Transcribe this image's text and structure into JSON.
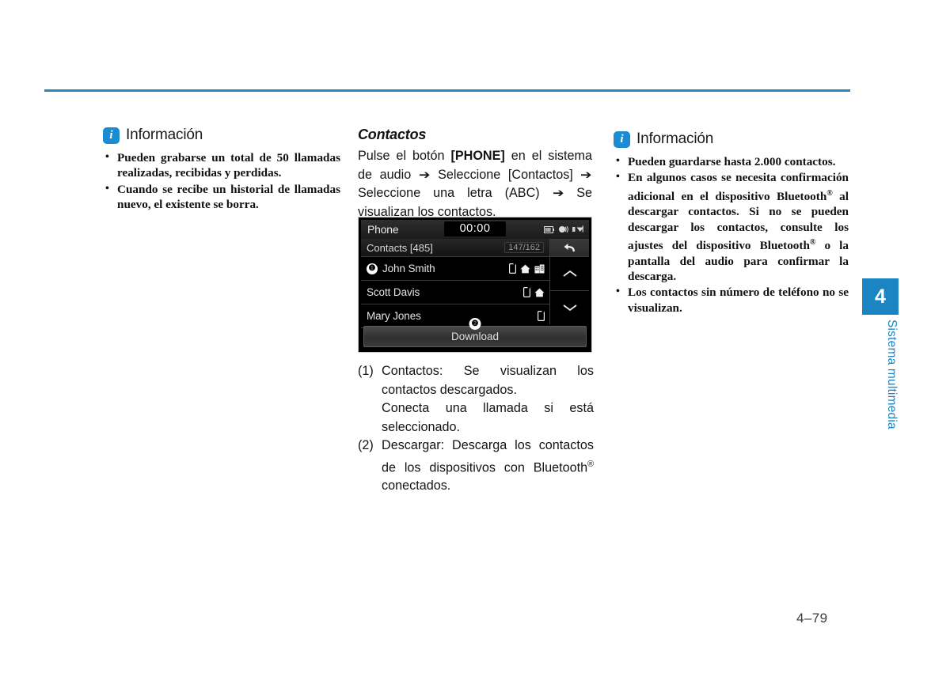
{
  "page": {
    "number": "4–79",
    "chapter_tab": {
      "number": "4",
      "label": "Sistema multimedia"
    }
  },
  "left_column": {
    "info_heading": "Información",
    "info_icon": "info-icon",
    "bullets": [
      "Pueden grabarse un total de 50 llamadas realizadas, recibidas y perdidas.",
      "Cuando se recibe un historial de llamadas nuevo, el existente se borra."
    ]
  },
  "middle_column": {
    "title": "Contactos",
    "paragraph": {
      "part1": "Pulse el botón ",
      "bold1": "[PHONE]",
      "part2": " en el sistema de audio ",
      "arrow1": "➔",
      "part3": " Seleccione [Contactos] ",
      "arrow2": "➔",
      "part4": " Seleccione una letra (ABC) ",
      "arrow3": "➔",
      "part5": " Se visualizan los contactos."
    },
    "numbered_items": [
      {
        "num": "(1)",
        "text": "Contactos: Se visualizan los contactos descargados.",
        "sub": "Conecta una llamada si está seleccionado."
      },
      {
        "num": "(2)",
        "text_a": "Descargar: Descarga los contactos de los dispositivos con Bluetooth",
        "sup": "®",
        "text_b": " conectados."
      }
    ]
  },
  "device_screenshot": {
    "status_bar": {
      "title": "Phone",
      "clock": "00:00",
      "icons": [
        "battery-icon",
        "volume-icon",
        "signal-icon"
      ]
    },
    "sub_bar": {
      "label": "Contacts [485]",
      "count": "147/162"
    },
    "rows": [
      {
        "badge": "❶",
        "name": "John Smith",
        "icons": [
          "mobile-icon",
          "home-icon",
          "office-icon"
        ]
      },
      {
        "badge": "",
        "name": "Scott Davis",
        "icons": [
          "mobile-icon",
          "home-icon"
        ]
      },
      {
        "badge": "",
        "name": "Mary Jones",
        "icons": [
          "mobile-icon"
        ]
      }
    ],
    "side_buttons": [
      "back-icon",
      "chevron-up-icon",
      "chevron-down-icon"
    ],
    "download_button": {
      "label": "Download",
      "callout": "❷"
    }
  },
  "right_column": {
    "info_heading": "Información",
    "info_icon": "info-icon",
    "bullets": [
      {
        "text": "Pueden guardarse hasta 2.000 contactos."
      },
      {
        "text_a": "En algunos casos se necesita confirmación adicional en el dispositivo Bluetooth",
        "sup_a": "®",
        "text_b": " al descargar contactos. Si no se pueden descargar los contactos, consulte los ajustes del dispositivo Bluetooth",
        "sup_b": "®",
        "text_c": " o la pantalla del audio para confirmar la descarga."
      },
      {
        "text": "Los contactos sin número de teléfono no se visualizan."
      }
    ]
  },
  "colors": {
    "accent_blue": "#1b85c4",
    "rule_blue": "#2b86c0",
    "device_black": "#000000"
  }
}
